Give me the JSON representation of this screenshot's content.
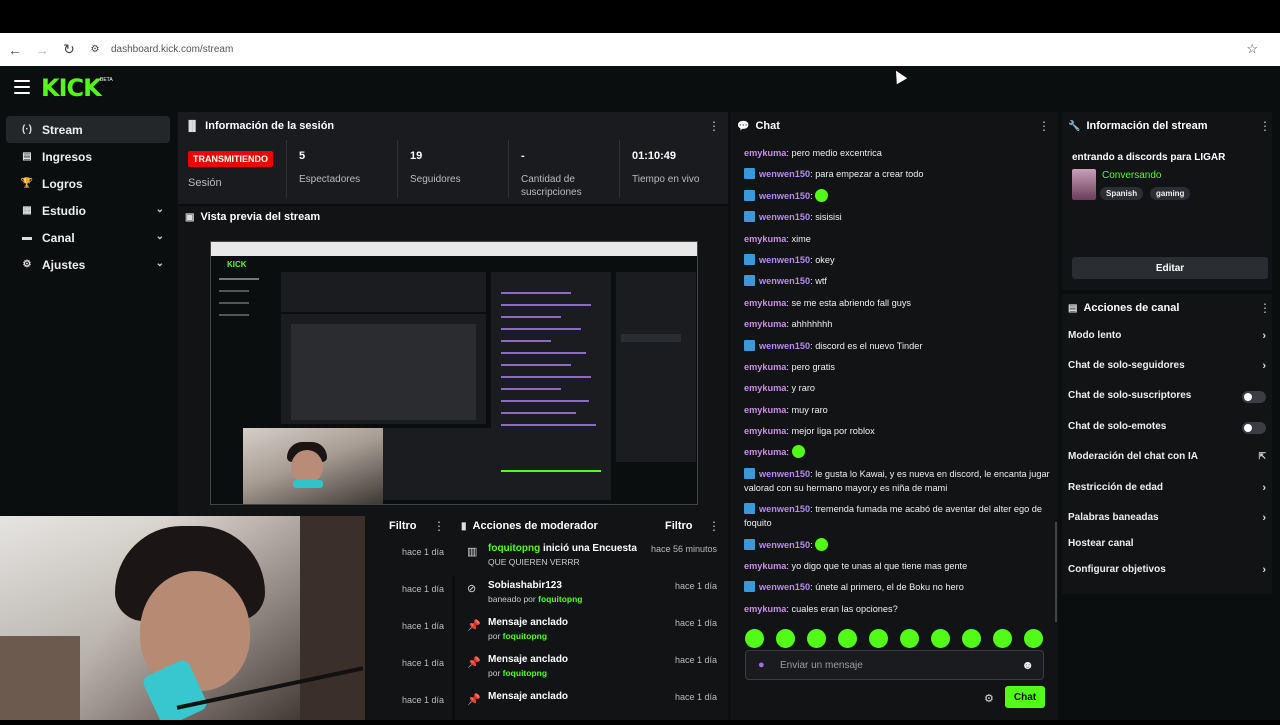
{
  "browser": {
    "url": "dashboard.kick.com/stream"
  },
  "header": {
    "logo": "KICK",
    "beta": "BETA"
  },
  "sidebar": {
    "items": [
      {
        "label": "Stream",
        "icon": "broadcast-icon",
        "glyph": "(·)",
        "expandable": false,
        "active": true
      },
      {
        "label": "Ingresos",
        "icon": "money-icon",
        "glyph": "▤",
        "expandable": false,
        "active": false
      },
      {
        "label": "Logros",
        "icon": "trophy-icon",
        "glyph": "🏆",
        "expandable": false,
        "active": false
      },
      {
        "label": "Estudio",
        "icon": "studio-icon",
        "glyph": "▦",
        "expandable": true,
        "active": false
      },
      {
        "label": "Canal",
        "icon": "channel-icon",
        "glyph": "▬",
        "expandable": true,
        "active": false
      },
      {
        "label": "Ajustes",
        "icon": "settings-icon",
        "glyph": "⚙",
        "expandable": true,
        "active": false
      }
    ],
    "chevron": "⌄"
  },
  "session": {
    "title": "Información de la sesión",
    "badge": "TRANSMITIENDO",
    "badge_label": "Sesión",
    "stats": [
      {
        "value": "5",
        "label": "Espectadores"
      },
      {
        "value": "19",
        "label": "Seguidores"
      },
      {
        "value": "-",
        "label": "Cantidad de suscripciones"
      },
      {
        "value": "01:10:49",
        "label": "Tiempo en vivo"
      }
    ]
  },
  "preview": {
    "title": "Vista previa del stream"
  },
  "modlog": {
    "filter": "Filtro",
    "times": [
      "hace 1 día",
      "hace 1 día",
      "hace 1 día",
      "hace 1 día",
      "hace 1 día"
    ]
  },
  "mod_actions": {
    "title": "Acciones de moderador",
    "filter": "Filtro",
    "rows": [
      {
        "icon": "poll-icon",
        "glyph": "▥",
        "user": "foquitopng",
        "text": " inició una Encuesta",
        "sub_prefix": "",
        "sub_user": "",
        "sub_text": "QUE QUIEREN VERRR",
        "time": "hace 56 minutos"
      },
      {
        "icon": "ban-icon",
        "glyph": "⊘",
        "user": "",
        "text": "Sobiashabir123",
        "sub_prefix": "baneado por ",
        "sub_user": "foquitopng",
        "sub_text": "",
        "time": "hace 1 día"
      },
      {
        "icon": "pin-icon",
        "glyph": "📌",
        "user": "",
        "text": "Mensaje anclado",
        "sub_prefix": "por ",
        "sub_user": "foquitopng",
        "sub_text": "",
        "time": "hace 1 día"
      },
      {
        "icon": "pin-icon",
        "glyph": "📌",
        "user": "",
        "text": "Mensaje anclado",
        "sub_prefix": "por ",
        "sub_user": "foquitopng",
        "sub_text": "",
        "time": "hace 1 día"
      },
      {
        "icon": "pin-icon",
        "glyph": "📌",
        "user": "",
        "text": "Mensaje anclado",
        "sub_prefix": "",
        "sub_user": "",
        "sub_text": "",
        "time": "hace 1 día"
      }
    ]
  },
  "chat": {
    "title": "Chat",
    "messages": [
      {
        "user": "emykuma",
        "badge": false,
        "text": "pero medio excentrica",
        "emote": false
      },
      {
        "user": "wenwen150",
        "badge": true,
        "text": "para empezar a crear todo",
        "emote": false
      },
      {
        "user": "wenwen150",
        "badge": true,
        "text": "",
        "emote": true
      },
      {
        "user": "wenwen150",
        "badge": true,
        "text": "sisisisi",
        "emote": false
      },
      {
        "user": "emykuma",
        "badge": false,
        "text": "xime",
        "emote": false
      },
      {
        "user": "wenwen150",
        "badge": true,
        "text": "okey",
        "emote": false
      },
      {
        "user": "wenwen150",
        "badge": true,
        "text": "wtf",
        "emote": false
      },
      {
        "user": "emykuma",
        "badge": false,
        "text": "se me esta abriendo fall guys",
        "emote": false
      },
      {
        "user": "emykuma",
        "badge": false,
        "text": "ahhhhhhh",
        "emote": false
      },
      {
        "user": "wenwen150",
        "badge": true,
        "text": "discord es el nuevo Tinder",
        "emote": false
      },
      {
        "user": "emykuma",
        "badge": false,
        "text": "pero gratis",
        "emote": false
      },
      {
        "user": "emykuma",
        "badge": false,
        "text": "y raro",
        "emote": false
      },
      {
        "user": "emykuma",
        "badge": false,
        "text": "muy raro",
        "emote": false
      },
      {
        "user": "emykuma",
        "badge": false,
        "text": "mejor liga por roblox",
        "emote": false
      },
      {
        "user": "emykuma",
        "badge": false,
        "text": "",
        "emote": true
      },
      {
        "user": "wenwen150",
        "badge": true,
        "text": "le gusta lo Kawai, y es nueva en discord, le encanta jugar valorad con su hermano mayor,y es niña de mami",
        "emote": false
      },
      {
        "user": "wenwen150",
        "badge": true,
        "text": "tremenda fumada me acabó de aventar del alter ego de foquito",
        "emote": false
      },
      {
        "user": "wenwen150",
        "badge": true,
        "text": "",
        "emote": true
      },
      {
        "user": "emykuma",
        "badge": false,
        "text": "yo digo que te unas al que tiene mas gente",
        "emote": false
      },
      {
        "user": "wenwen150",
        "badge": true,
        "text": "únete al primero, el de Boku no hero",
        "emote": false
      },
      {
        "user": "emykuma",
        "badge": false,
        "text": "cuales eran las opciones?",
        "emote": false
      }
    ],
    "emote_count": 10,
    "input_placeholder": "Enviar un mensaje",
    "send_label": "Chat",
    "colors": {
      "accent": "#53fc18",
      "emykuma": "#c98fe4",
      "wenwen150": "#b58cf0",
      "badge": "#3b98d9"
    }
  },
  "stream_info": {
    "title": "Información del stream",
    "stream_title": "entrando a discords para LIGAR",
    "category": "Conversando",
    "tags": [
      "Spanish",
      "gaming"
    ],
    "edit_label": "Editar"
  },
  "channel_actions": {
    "title": "Acciones de canal",
    "rows": [
      {
        "label": "Modo lento",
        "control": "chevron"
      },
      {
        "label": "Chat de solo-seguidores",
        "control": "chevron"
      },
      {
        "label": "Chat de solo-suscriptores",
        "control": "toggle"
      },
      {
        "label": "Chat de solo-emotes",
        "control": "toggle"
      },
      {
        "label": "Moderación del chat con IA",
        "control": "external"
      },
      {
        "label": "Restricción de edad",
        "control": "chevron"
      },
      {
        "label": "Palabras baneadas",
        "control": "chevron"
      },
      {
        "label": "Hostear canal",
        "control": "none"
      },
      {
        "label": "Configurar objetivos",
        "control": "chevron"
      }
    ]
  }
}
